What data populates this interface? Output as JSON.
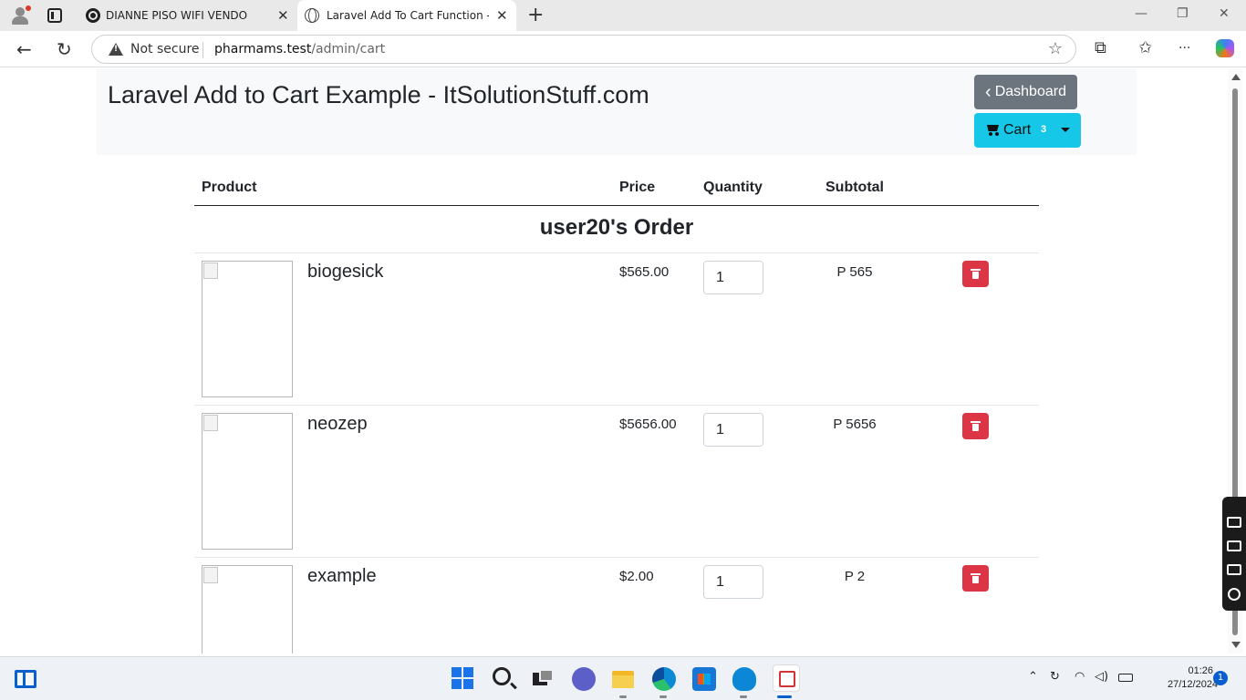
{
  "browser": {
    "tabs": [
      {
        "title": "DIANNE PISO WIFI VENDO",
        "active": false
      },
      {
        "title": "Laravel Add To Cart Function - ItS",
        "active": true
      }
    ],
    "address": {
      "security": "Not secure",
      "host": "pharmams.test",
      "path": "/admin/cart"
    },
    "controls": {
      "close_tab": "✕",
      "new_tab": "+",
      "minimize": "—",
      "restore": "❐",
      "close": "✕",
      "back": "←",
      "reload": "↻",
      "star": "☆",
      "extensions": "⧉",
      "favorites": "✩",
      "more": "···"
    }
  },
  "page": {
    "title": "Laravel Add to Cart Example - ItSolutionStuff.com",
    "dashboard_button": "Dashboard",
    "dashboard_chevron": "‹",
    "cart_button": "Cart",
    "cart_count": "3",
    "table": {
      "headers": [
        "Product",
        "Price",
        "Quantity",
        "Subtotal"
      ],
      "order_title": "user20's Order",
      "items": [
        {
          "name": "biogesick",
          "price": "$565.00",
          "quantity": "1",
          "subtotal": "P 565"
        },
        {
          "name": "neozep",
          "price": "$5656.00",
          "quantity": "1",
          "subtotal": "P 5656"
        },
        {
          "name": "example",
          "price": "$2.00",
          "quantity": "1",
          "subtotal": "P 2"
        }
      ]
    },
    "colors": {
      "dashboard_bg": "#6c757d",
      "cart_bg": "#17c7e8",
      "delete_bg": "#dc3545"
    }
  },
  "taskbar": {
    "time": "01:26",
    "date": "27/12/2024",
    "notifications": "1",
    "tray_icons": [
      "chevron-up-icon",
      "sync-icon",
      "wifi-icon",
      "volume-icon",
      "battery-icon"
    ]
  }
}
